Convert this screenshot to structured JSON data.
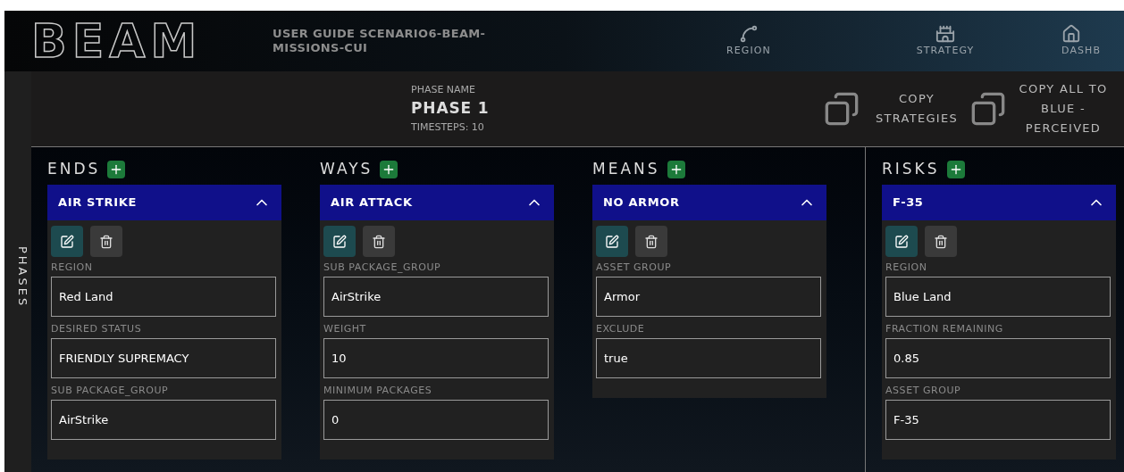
{
  "header": {
    "logo": "BEAM",
    "title": "USER GUIDE SCENARIO6-BEAM-MISSIONS-CUI",
    "nav": [
      {
        "label": "REGION"
      },
      {
        "label": "STRATEGY"
      },
      {
        "label": "DASHB"
      }
    ]
  },
  "sidebar": {
    "label": "PHASES"
  },
  "phase": {
    "caption": "PHASE NAME",
    "name": "PHASE 1",
    "timesteps": "TIMESTEPS: 10",
    "actions": [
      "COPY STRATEGIES",
      "COPY ALL TO BLUE - PERCEIVED"
    ]
  },
  "columns": [
    {
      "title": "ENDS",
      "cards": [
        {
          "title": "AIR STRIKE",
          "expanded": true,
          "fields": [
            {
              "label": "REGION",
              "value": "Red Land"
            },
            {
              "label": "DESIRED STATUS",
              "value": "FRIENDLY SUPREMACY"
            },
            {
              "label": "SUB PACKAGE_GROUP",
              "value": "AirStrike"
            }
          ]
        }
      ]
    },
    {
      "title": "WAYS",
      "cards": [
        {
          "title": "AIR ATTACK",
          "expanded": true,
          "fields": [
            {
              "label": "SUB PACKAGE_GROUP",
              "value": "AirStrike"
            },
            {
              "label": "WEIGHT",
              "value": "10"
            },
            {
              "label": "MINIMUM PACKAGES",
              "value": "0"
            }
          ]
        }
      ]
    },
    {
      "title": "MEANS",
      "cards": [
        {
          "title": "NO ARMOR",
          "expanded": true,
          "fields": [
            {
              "label": "ASSET GROUP",
              "value": "Armor"
            },
            {
              "label": "EXCLUDE",
              "value": "true"
            }
          ]
        }
      ]
    },
    {
      "title": "RISKS",
      "cards": [
        {
          "title": "F-35",
          "expanded": true,
          "fields": [
            {
              "label": "REGION",
              "value": "Blue Land"
            },
            {
              "label": "FRACTION REMAINING",
              "value": "0.85"
            },
            {
              "label": "ASSET GROUP",
              "value": "F-35"
            }
          ]
        }
      ]
    }
  ]
}
